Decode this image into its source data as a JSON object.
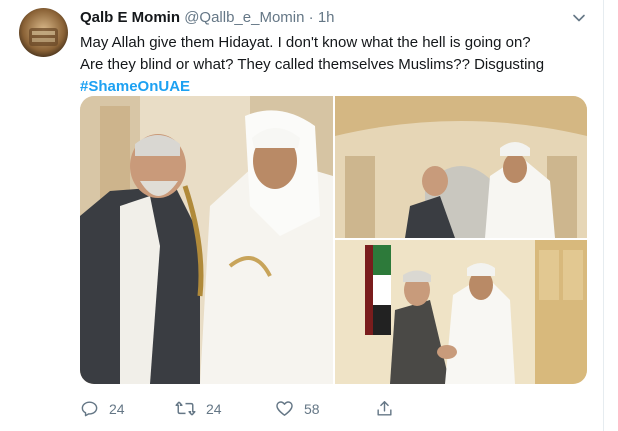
{
  "tweet": {
    "author_name": "Qalb E Momin",
    "author_handle": "@Qallb_e_Momin",
    "separator": "·",
    "timestamp": "1h",
    "text": "May Allah give them Hidayat. I don't know what the hell is going on? Are they blind or what? They called themselves Muslims?? Disgusting",
    "hashtag": "#ShameOnUAE"
  },
  "media": {
    "photos": [
      {
        "desc_icon": "photo"
      },
      {
        "desc_icon": "photo"
      },
      {
        "desc_icon": "photo"
      }
    ]
  },
  "actions": {
    "reply_count": "24",
    "retweet_count": "24",
    "like_count": "58",
    "icons": [
      "reply-icon",
      "retweet-icon",
      "like-icon",
      "share-icon"
    ]
  },
  "colors": {
    "link": "#1da1f2",
    "secondary_text": "#657786",
    "border": "#e6ecf0"
  }
}
